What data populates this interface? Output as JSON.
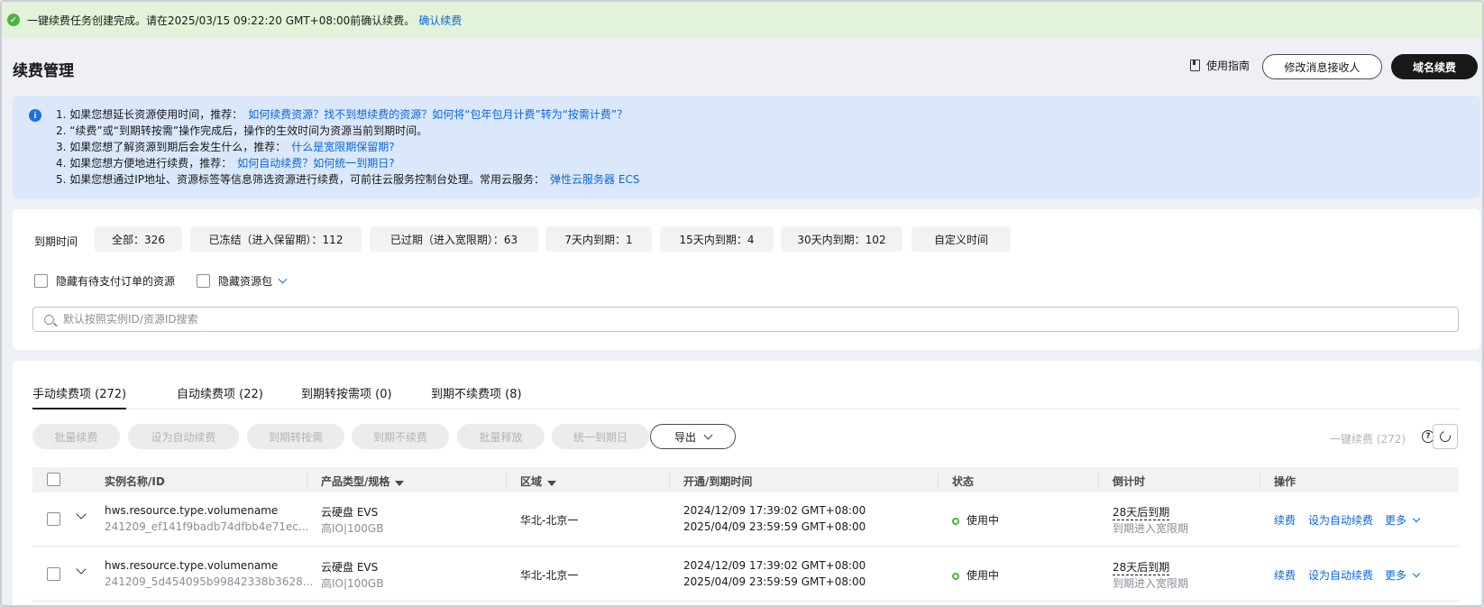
{
  "banner": {
    "message": "一键续费任务创建完成。请在2025/03/15 09:22:20 GMT+08:00前确认续费。",
    "link": "确认续费"
  },
  "header": {
    "title": "续费管理",
    "guide_label": "使用指南",
    "modify_recipient_label": "修改消息接收人",
    "domain_renew_label": "域名续费"
  },
  "info": {
    "lines": [
      {
        "text": "1. 如果您想延长资源使用时间，推荐：",
        "link": "如何续费资源？找不到想续费的资源？如何将“包年包月计费”转为“按需计费”？"
      },
      {
        "text": "2. “续费”或“到期转按需”操作完成后，操作的生效时间为资源当前到期时间。",
        "link": ""
      },
      {
        "text": "3. 如果您想了解资源到期后会发生什么，推荐：",
        "link": "什么是宽限期保留期?"
      },
      {
        "text": "4. 如果您想方便地进行续费，推荐：",
        "link": "如何自动续费？如何统一到期日?"
      },
      {
        "text": "5. 如果您想通过IP地址、资源标签等信息筛选资源进行续费，可前往云服务控制台处理。常用云服务：",
        "link": "弹性云服务器 ECS"
      }
    ]
  },
  "filter": {
    "label": "到期时间",
    "chips": [
      "全部：326",
      "已冻结（进入保留期）：112",
      "已过期（进入宽限期）：63",
      "7天内到期：1",
      "15天内到期：4",
      "30天内到期：102",
      "自定义时间"
    ],
    "hide_pending_label": "隐藏有待支付订单的资源",
    "hide_package_label": "隐藏资源包",
    "search_placeholder": "默认按照实例ID/资源ID搜索"
  },
  "tabs": [
    "手动续费项 (272)",
    "自动续费项 (22)",
    "到期转按需项 (0)",
    "到期不续费项 (8)"
  ],
  "toolbar": {
    "buttons": [
      "批量续费",
      "设为自动续费",
      "到期转按需",
      "到期不续费",
      "批量释放",
      "统一到期日"
    ],
    "export_label": "导出",
    "one_click_label": "一键续费 (272)"
  },
  "table": {
    "headers": [
      "实例名称/ID",
      "产品类型/规格",
      "区域",
      "开通/到期时间",
      "状态",
      "倒计时",
      "操作"
    ],
    "rows": [
      {
        "name": "hws.resource.type.volumename",
        "id": "241209_ef141f9badb74dfbb4e71ec...",
        "product": "云硬盘 EVS",
        "spec": "高IO|100GB",
        "region": "华北-北京一",
        "open_time": "2024/12/09 17:39:02 GMT+08:00",
        "expire_time": "2025/04/09 23:59:59 GMT+08:00",
        "status": "使用中",
        "countdown": "28天后到期",
        "countdown_sub": "到期进入宽限期",
        "action_renew": "续费",
        "action_auto": "设为自动续费",
        "action_more": "更多"
      },
      {
        "name": "hws.resource.type.volumename",
        "id": "241209_5d454095b99842338b3628...",
        "product": "云硬盘 EVS",
        "spec": "高IO|100GB",
        "region": "华北-北京一",
        "open_time": "2024/12/09 17:39:02 GMT+08:00",
        "expire_time": "2025/04/09 23:59:59 GMT+08:00",
        "status": "使用中",
        "countdown": "28天后到期",
        "countdown_sub": "到期进入宽限期",
        "action_renew": "续费",
        "action_auto": "设为自动续费",
        "action_more": "更多"
      }
    ]
  },
  "colors": {
    "accent": "#0a67d6",
    "success": "#50b142",
    "banner_bg": "#e3f3d9",
    "info_bg": "#dbe8fb"
  }
}
